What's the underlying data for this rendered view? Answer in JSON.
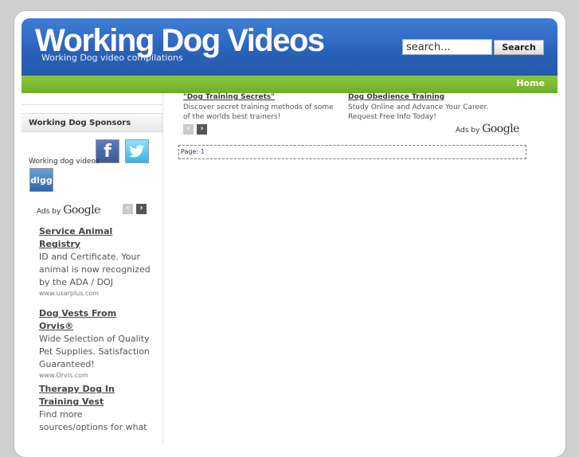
{
  "header": {
    "title": "Working Dog Videos",
    "subtitle": "Working Dog video compilations",
    "search_placeholder": "search...",
    "search_button": "Search"
  },
  "nav": {
    "home": "Home"
  },
  "sidebar": {
    "sponsors_heading": "Working Dog Sponsors",
    "social_label": "Working dog videos",
    "facebook_glyph": "f",
    "digg_glyph": "digg",
    "ads_by": "Ads by",
    "google": "Google",
    "ads": [
      {
        "title": "Service Animal Registry",
        "desc": "ID and Certificate. Your animal is now recognized by the ADA / DOJ",
        "url": "www.usarplus.com"
      },
      {
        "title": "Dog Vests From Orvis®",
        "desc": "Wide Selection of Quality Pet Supplies. Satisfaction Guaranteed!",
        "url": "www.Orvis.com"
      },
      {
        "title": "Therapy Dog In Training Vest",
        "desc": "Find more sources/options for what",
        "url": ""
      }
    ]
  },
  "top_ads": {
    "ads_by": "Ads by",
    "google": "Google",
    "items": [
      {
        "title": "\"Dog Training Secrets\"",
        "desc": "Discover secret training methods of some of the worlds best trainers!"
      },
      {
        "title": "Dog Obedience Training",
        "desc": "Study Online and Advance Your Career. Request Free Info Today!"
      }
    ]
  },
  "pager": {
    "label": "Page:",
    "current": "1"
  },
  "icons": {
    "prev": "‹",
    "next": "›"
  },
  "colors": {
    "header_blue": "#2a61b8",
    "nav_green": "#7ab832"
  }
}
